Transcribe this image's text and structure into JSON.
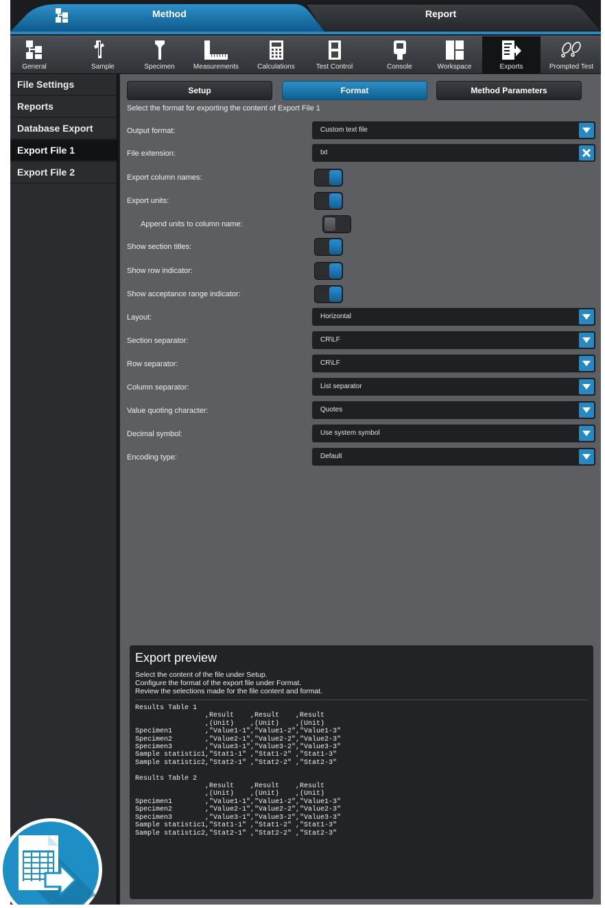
{
  "top_tabs": [
    {
      "label": "Method",
      "active": true
    },
    {
      "label": "Report",
      "active": false
    }
  ],
  "toolbar": [
    {
      "label": "General",
      "icon": "general-icon"
    },
    {
      "label": "Sample",
      "icon": "sample-icon"
    },
    {
      "label": "Specimen",
      "icon": "specimen-icon"
    },
    {
      "label": "Measurements",
      "icon": "measurements-icon"
    },
    {
      "label": "Calculations",
      "icon": "calculator-icon"
    },
    {
      "label": "Test Control",
      "icon": "test-control-icon"
    },
    {
      "label": "Console",
      "icon": "console-icon"
    },
    {
      "label": "Workspace",
      "icon": "workspace-icon"
    },
    {
      "label": "Exports",
      "icon": "exports-icon",
      "active": true
    },
    {
      "label": "Prompted Test",
      "icon": "footsteps-icon"
    }
  ],
  "sidebar": {
    "items": [
      {
        "label": "File Settings"
      },
      {
        "label": "Reports"
      },
      {
        "label": "Database Export"
      },
      {
        "label": "Export File 1",
        "active": true
      },
      {
        "label": "Export File 2"
      }
    ]
  },
  "subtabs": [
    {
      "label": "Setup"
    },
    {
      "label": "Format",
      "active": true
    },
    {
      "label": "Method Parameters"
    }
  ],
  "description": "Select the format for exporting the content of Export File 1",
  "fields": {
    "output_format": {
      "label": "Output format:",
      "value": "Custom text file"
    },
    "file_extension": {
      "label": "File extension:",
      "value": "txt"
    },
    "export_column_names": {
      "label": "Export column names:",
      "on": true
    },
    "export_units": {
      "label": "Export units:",
      "on": true
    },
    "append_units": {
      "label": "Append units to column name:",
      "on": false
    },
    "show_section_titles": {
      "label": "Show section titles:",
      "on": true
    },
    "show_row_indicator": {
      "label": "Show row indicator:",
      "on": true
    },
    "show_acceptance": {
      "label": "Show acceptance range indicator:",
      "on": true
    },
    "layout": {
      "label": "Layout:",
      "value": "Horizontal"
    },
    "section_separator": {
      "label": "Section separator:",
      "value": "CR\\LF"
    },
    "row_separator": {
      "label": "Row separator:",
      "value": "CR\\LF"
    },
    "column_separator": {
      "label": "Column separator:",
      "value": "List separator"
    },
    "value_quoting": {
      "label": "Value quoting character:",
      "value": "Quotes"
    },
    "decimal_symbol": {
      "label": "Decimal symbol:",
      "value": "Use system symbol"
    },
    "encoding_type": {
      "label": "Encoding type:",
      "value": "Default"
    }
  },
  "preview": {
    "title": "Export preview",
    "lines": [
      "Select the content of the file under Setup.",
      "Configure the format of the export file under Format.",
      "Review the selections made for the file content and format."
    ],
    "content": "Results Table 1\n                 ,Result    ,Result    ,Result\n                 ,(Unit)    ,(Unit)    ,(Unit)\nSpecimen1        ,\"Value1-1\",\"Value1-2\",\"Value1-3\"\nSpecimen2        ,\"Value2-1\",\"Value2-2\",\"Value2-3\"\nSpecimen3        ,\"Value3-1\",\"Value3-2\",\"Value3-3\"\nSample statistic1,\"Stat1-1\" ,\"Stat1-2\" ,\"Stat1-3\"\nSample statistic2,\"Stat2-1\" ,\"Stat2-2\" ,\"Stat2-3\"\n\nResults Table 2\n                 ,Result    ,Result    ,Result\n                 ,(Unit)    ,(Unit)    ,(Unit)\nSpecimen1        ,\"Value1-1\",\"Value1-2\",\"Value1-3\"\nSpecimen2        ,\"Value2-1\",\"Value2-2\",\"Value2-3\"\nSpecimen3        ,\"Value3-1\",\"Value3-2\",\"Value3-3\"\nSample statistic1,\"Stat1-1\" ,\"Stat1-2\" ,\"Stat1-3\"\nSample statistic2,\"Stat2-1\" ,\"Stat2-2\" ,\"Stat2-3\""
  },
  "colors": {
    "accent": "#2a88c0",
    "panel": "#5c5e62",
    "sidebar": "#2a2c30",
    "badge": "#1d8fc4"
  },
  "badge_icon": "export-table-icon"
}
